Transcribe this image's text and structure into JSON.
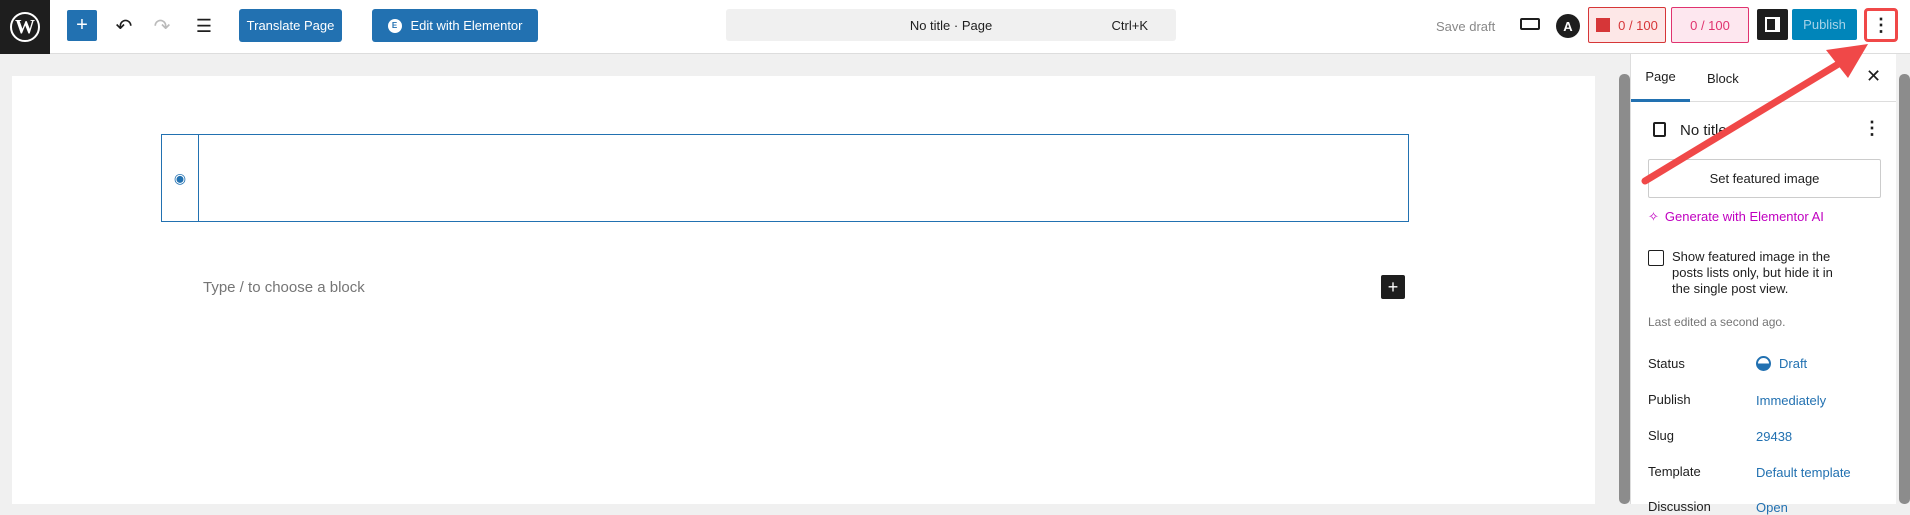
{
  "toolbar": {
    "translate": "Translate Page",
    "elementor": "Edit with Elementor",
    "command_title": "No title · Page",
    "command_shortcut": "Ctrl+K",
    "save_draft": "Save draft",
    "score1": "0 / 100",
    "score2": "0 / 100",
    "publish": "Publish"
  },
  "editor": {
    "placeholder": "Type / to choose a block"
  },
  "sidebar": {
    "tabs": [
      "Page",
      "Block"
    ],
    "title": "No title",
    "set_featured": "Set featured image",
    "generate_ai": "Generate with Elementor AI",
    "checkbox_label": "Show featured image in the posts lists only, but hide it in the single post view.",
    "last_edited": "Last edited a second ago.",
    "fields": [
      {
        "label": "Status",
        "value": "Draft"
      },
      {
        "label": "Publish",
        "value": "Immediately"
      },
      {
        "label": "Slug",
        "value": "29438"
      },
      {
        "label": "Template",
        "value": "Default template"
      },
      {
        "label": "Discussion",
        "value": "Open"
      }
    ]
  },
  "colors": {
    "accent": "#2271b1",
    "annotation": "#f04848",
    "ai": "#c000c0"
  }
}
